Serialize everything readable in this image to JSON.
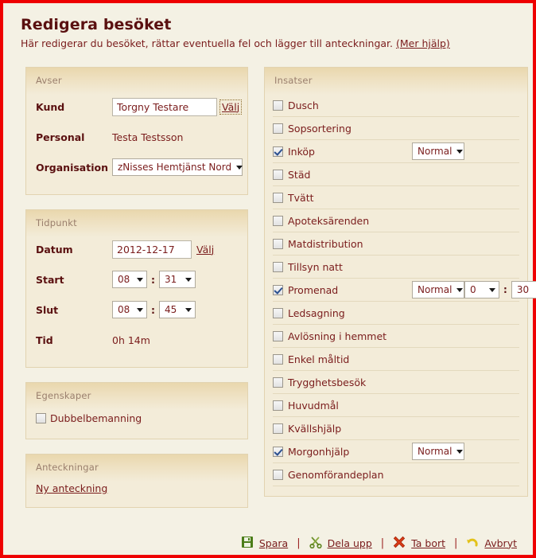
{
  "header": {
    "title": "Redigera besöket",
    "subtitle": "Här redigerar du besöket, rättar eventuella fel och lägger till anteckningar.",
    "help_link": "(Mer hjälp)"
  },
  "avser": {
    "title": "Avser",
    "kund_label": "Kund",
    "kund_value": "Torgny Testare",
    "kund_valj": "Välj",
    "personal_label": "Personal",
    "personal_value": "Testa Testsson",
    "organisation_label": "Organisation",
    "organisation_value": "zNisses Hemtjänst Nord"
  },
  "tidpunkt": {
    "title": "Tidpunkt",
    "datum_label": "Datum",
    "datum_value": "2012-12-17",
    "datum_valj": "Välj",
    "start_label": "Start",
    "start_hour": "08",
    "start_minute": "31",
    "slut_label": "Slut",
    "slut_hour": "08",
    "slut_minute": "45",
    "tid_label": "Tid",
    "tid_value": "0h 14m",
    "colon": ":"
  },
  "egenskaper": {
    "title": "Egenskaper",
    "dubbelbemanning_label": "Dubbelbemanning",
    "dubbelbemanning_checked": false
  },
  "anteckningar": {
    "title": "Anteckningar",
    "new_note_link": "Ny anteckning"
  },
  "insatser": {
    "title": "Insatser",
    "items": [
      {
        "label": "Dusch",
        "checked": false,
        "level": null,
        "hours": null,
        "minutes": null
      },
      {
        "label": "Sopsortering",
        "checked": false,
        "level": null,
        "hours": null,
        "minutes": null
      },
      {
        "label": "Inköp",
        "checked": true,
        "level": "Normal",
        "hours": null,
        "minutes": null
      },
      {
        "label": "Städ",
        "checked": false,
        "level": null,
        "hours": null,
        "minutes": null
      },
      {
        "label": "Tvätt",
        "checked": false,
        "level": null,
        "hours": null,
        "minutes": null
      },
      {
        "label": "Apoteksärenden",
        "checked": false,
        "level": null,
        "hours": null,
        "minutes": null
      },
      {
        "label": "Matdistribution",
        "checked": false,
        "level": null,
        "hours": null,
        "minutes": null
      },
      {
        "label": "Tillsyn natt",
        "checked": false,
        "level": null,
        "hours": null,
        "minutes": null
      },
      {
        "label": "Promenad",
        "checked": true,
        "level": "Normal",
        "hours": "0",
        "minutes": "30"
      },
      {
        "label": "Ledsagning",
        "checked": false,
        "level": null,
        "hours": null,
        "minutes": null
      },
      {
        "label": "Avlösning i hemmet",
        "checked": false,
        "level": null,
        "hours": null,
        "minutes": null
      },
      {
        "label": "Enkel måltid",
        "checked": false,
        "level": null,
        "hours": null,
        "minutes": null
      },
      {
        "label": "Trygghetsbesök",
        "checked": false,
        "level": null,
        "hours": null,
        "minutes": null
      },
      {
        "label": "Huvudmål",
        "checked": false,
        "level": null,
        "hours": null,
        "minutes": null
      },
      {
        "label": "Kvällshjälp",
        "checked": false,
        "level": null,
        "hours": null,
        "minutes": null
      },
      {
        "label": "Morgonhjälp",
        "checked": true,
        "level": "Normal",
        "hours": null,
        "minutes": null
      },
      {
        "label": "Genomförandeplan",
        "checked": false,
        "level": null,
        "hours": null,
        "minutes": null
      }
    ],
    "time_colon": ":"
  },
  "actions": {
    "separator": "|",
    "items": [
      {
        "label": "Spara",
        "icon": "save-floppy-icon"
      },
      {
        "label": "Dela upp",
        "icon": "scissors-icon"
      },
      {
        "label": "Ta bort",
        "icon": "delete-x-icon"
      },
      {
        "label": "Avbryt",
        "icon": "undo-arrow-icon"
      }
    ]
  },
  "colors": {
    "page_border": "#ee0000",
    "page_background": "#f4f1e4",
    "panel_header": "#e9d7ad",
    "panel_body": "#f3ecd9",
    "text": "#7a1c1c",
    "label": "#5a1010",
    "panel_title": "#9a7f6d",
    "checkmark": "#2a4f8f"
  }
}
